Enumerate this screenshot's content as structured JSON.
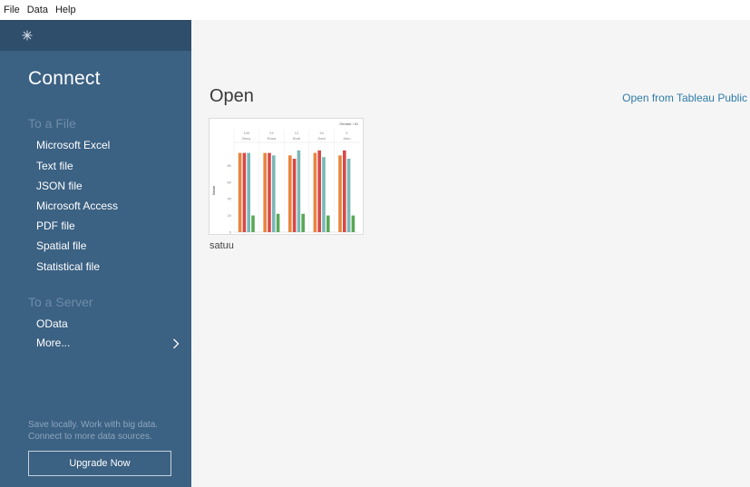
{
  "menu": [
    "File",
    "Data",
    "Help"
  ],
  "sidebar": {
    "title": "Connect",
    "file_header": "To a File",
    "file_items": [
      "Microsoft Excel",
      "Text file",
      "JSON file",
      "Microsoft Access",
      "PDF file",
      "Spatial file",
      "Statistical file"
    ],
    "server_header": "To a Server",
    "server_items": [
      "OData"
    ],
    "more_label": "More...",
    "promo_line1": "Save locally. Work with big data.",
    "promo_line2": "Connect to more data sources.",
    "upgrade_label": "Upgrade Now",
    "colors": {
      "background": "#3b6183",
      "header_strip": "#2f4e6b",
      "section": "#6e8ca7"
    }
  },
  "main": {
    "open_title": "Open",
    "public_link": "Open from Tableau Public",
    "workbook": {
      "name": "satuu",
      "legend_label": "Gender / ID",
      "ylabel": "Value",
      "yticks": [
        "80",
        "60",
        "40",
        "20",
        "0"
      ],
      "columns": [
        {
          "top": "100",
          "bottom": "Bony"
        },
        {
          "top": "24",
          "bottom": "Rosa"
        },
        {
          "top": "12",
          "bottom": "Budi"
        },
        {
          "top": "34",
          "bottom": "Dani"
        },
        {
          "top": "3",
          "bottom": "Joko"
        }
      ],
      "bar_colors": [
        "#e8853d",
        "#d94848",
        "#7ab8b8",
        "#5aa856"
      ],
      "bar_values": [
        [
          95,
          95,
          95,
          20
        ],
        [
          95,
          95,
          92,
          22
        ],
        [
          92,
          88,
          98,
          22
        ],
        [
          95,
          98,
          90,
          20
        ],
        [
          92,
          98,
          88,
          20
        ]
      ]
    }
  }
}
